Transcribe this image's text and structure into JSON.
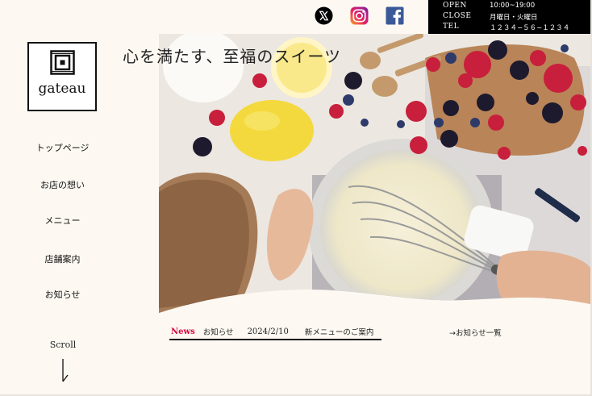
{
  "social": {
    "x_icon": "x-twitter-icon",
    "instagram_icon": "instagram-icon",
    "facebook_icon": "facebook-icon"
  },
  "info": {
    "open_label": "OPEN",
    "open_value": "10:00~19:00",
    "close_label": "CLOSE",
    "close_value": "月曜日・火曜日",
    "tel_label": "TEL",
    "tel_value": "１２３４−５６−１２３４"
  },
  "logo": {
    "text": "gateau"
  },
  "tagline": "心を満たす、至福のスイーツ",
  "nav": {
    "items": [
      {
        "label": "トップページ"
      },
      {
        "label": "お店の想い"
      },
      {
        "label": "メニュー"
      },
      {
        "label": "店舗案内"
      },
      {
        "label": "お知らせ"
      }
    ]
  },
  "scroll": {
    "label": "Scroll"
  },
  "news": {
    "badge": "News",
    "category": "お知らせ",
    "date": "2024/2/10",
    "title": "新メニューのご案内",
    "all_link": "→お知らせ一覧"
  },
  "colors": {
    "background": "#fdf9f2",
    "accent": "#d8003a",
    "info_bg": "#000000"
  }
}
